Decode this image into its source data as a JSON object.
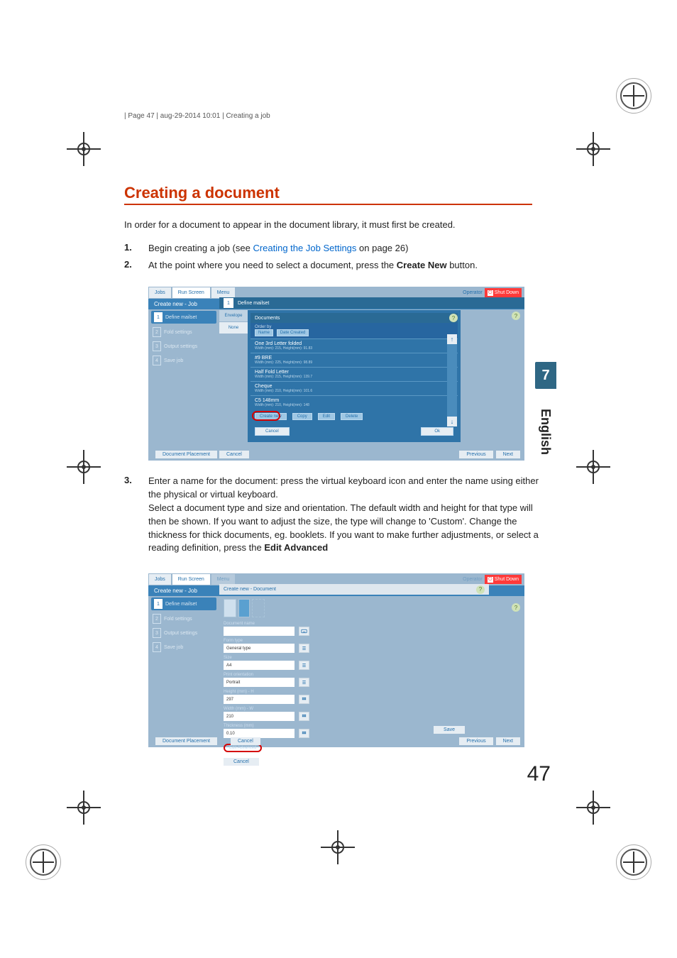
{
  "header": {
    "text": "| Page 47 | aug-29-2014 10:01 | Creating a job"
  },
  "title": "Creating a document",
  "intro": "In order for a document to appear in the document library, it must first be created.",
  "steps": {
    "s1": {
      "num": "1.",
      "pre": "Begin creating a job (see ",
      "link": "Creating the Job Settings",
      "post": " on page 26)"
    },
    "s2": {
      "num": "2.",
      "pre": "At the point where you need to select a document, press the ",
      "bold": "Create New",
      "post": " button."
    },
    "s3": {
      "num": "3.",
      "l1": "Enter a name for the document: press the virtual keyboard icon and enter the name using either the physical or virtual keyboard.",
      "l2a": "Select a document type and size and orientation. The default width and height for that type will then be shown. If you want to adjust the size, the type will change to 'Custom'. Change the thickness for thick documents, eg. booklets. If you want to make further adjustments, or select a reading definition, press the ",
      "l2b": "Edit Advanced"
    }
  },
  "sidetab": {
    "chapter": "7",
    "lang": "English"
  },
  "page_number": "47",
  "shot_common": {
    "jobs": "Jobs",
    "run": "Run Screen",
    "menu": "Menu",
    "operator": "Operator",
    "shutdown": "Shut Down",
    "crumb": "Create new - Job",
    "wiz1": "Define mailset",
    "wiz2": "Fold settings",
    "wiz3": "Output settings",
    "wiz4": "Save job",
    "docpl": "Document Placement",
    "cancel": "Cancel",
    "prev": "Previous",
    "next": "Next",
    "ok": "Ok",
    "save": "Save"
  },
  "shot1": {
    "sec_num": "1",
    "sec_title": "Define mailset",
    "vt_env": "Envelope",
    "vt_none": "None",
    "panel_title": "Documents",
    "order_lbl": "Order by",
    "order_name": "Name",
    "order_date": "Date Created",
    "items": [
      {
        "name": "One 3rd Letter folded",
        "det": "Width (mm): 215, Height(mm): 91.83"
      },
      {
        "name": "#9 BRE",
        "det": "Width (mm): 225, Height(mm): 98.89"
      },
      {
        "name": "Half Fold Letter",
        "det": "Width (mm): 215, Height(mm): 139.7"
      },
      {
        "name": "Cheque",
        "det": "Width (mm): 210, Height(mm): 101.6"
      },
      {
        "name": "C5 148mm",
        "det": "Width (mm): 210, Height(mm): 148"
      }
    ],
    "b_new": "Create new",
    "b_copy": "Copy",
    "b_edit": "Edit",
    "b_del": "Delete"
  },
  "shot2": {
    "modal_title": "Create new - Document",
    "f_name": "Document name",
    "f_name_v": "",
    "f_type": "Form type",
    "f_type_v": "General type",
    "f_size": "Size",
    "f_size_v": "A4",
    "f_orient": "Print orientation",
    "f_orient_v": "Portrait",
    "f_h": "Height (mm) - H",
    "f_h_v": "297",
    "f_w": "Width (mm) - W",
    "f_w_v": "210",
    "f_t": "Thickness (mm)",
    "f_t_v": "0.10",
    "editadv": "Edit Advanced"
  }
}
